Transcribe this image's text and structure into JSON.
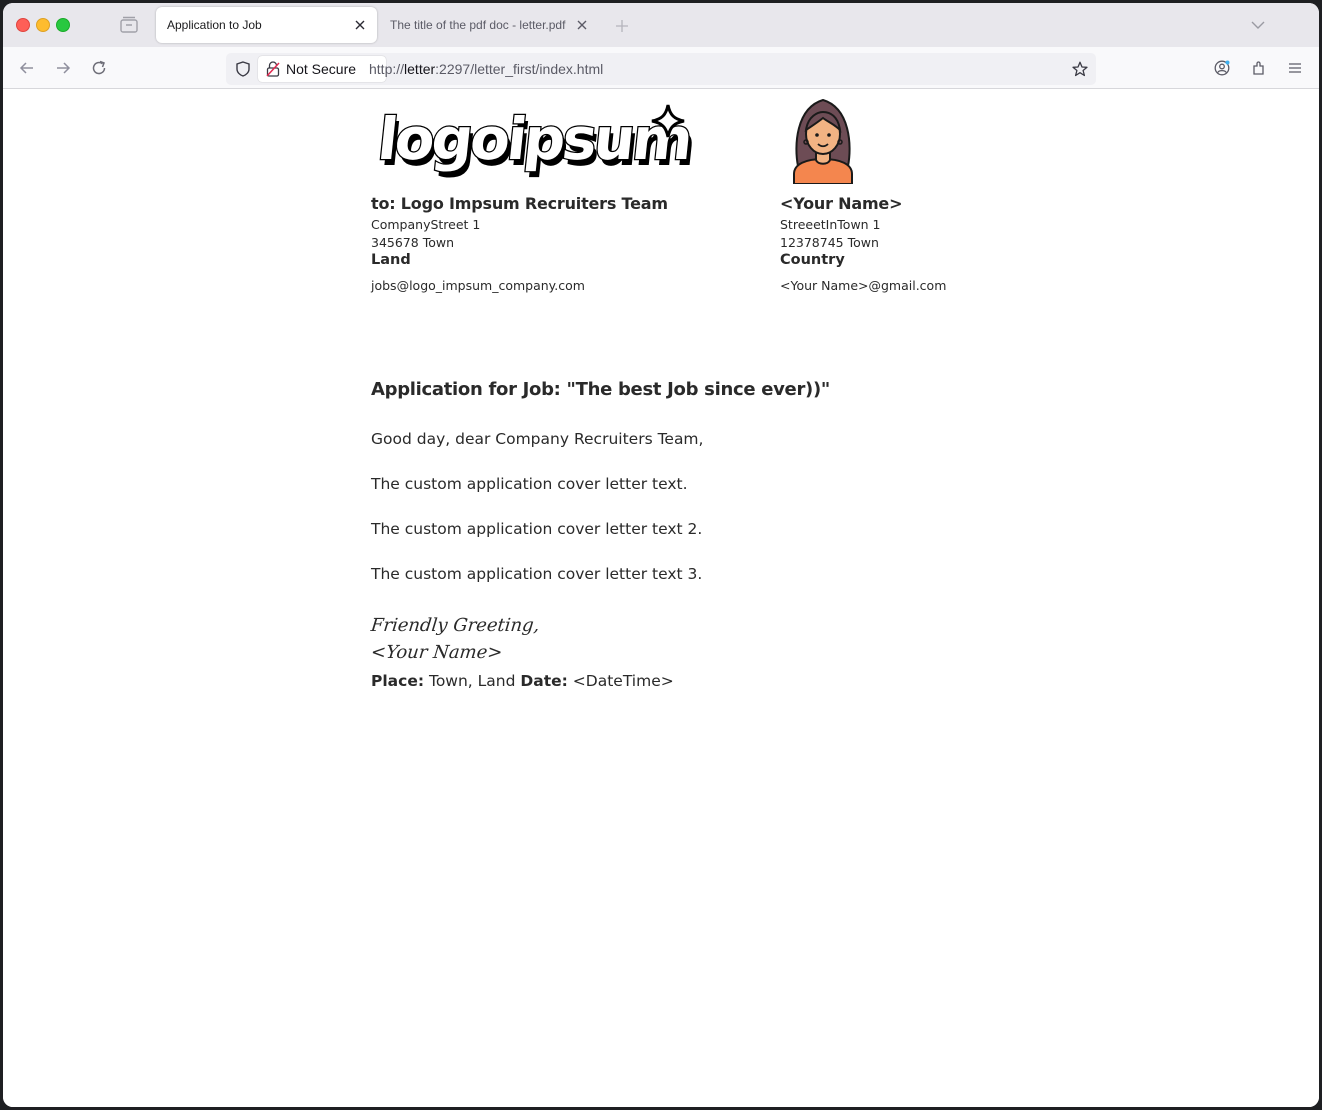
{
  "browser": {
    "tabs": [
      {
        "title": "Application to Job",
        "active": true
      },
      {
        "title": "The title of the pdf doc - letter.pdf",
        "active": false
      }
    ],
    "security_label": "Not Secure",
    "url_prefix": "http://",
    "url_host": "letter",
    "url_rest": ":2297/letter_first/index.html"
  },
  "letter": {
    "recipient": {
      "heading": "to: Logo Impsum Recruiters Team",
      "street": "CompanyStreet 1",
      "city": "345678  Town",
      "country": "Land",
      "email": "jobs@logo_impsum_company.com"
    },
    "sender": {
      "heading": "<Your Name>",
      "street": "StreeetInTown 1",
      "city": "12378745  Town",
      "country": "Country",
      "email": "<Your Name>@gmail.com"
    },
    "subject": "Application for Job: \"The best Job since ever))\"",
    "greeting": "Good day, dear Company Recruiters Team,",
    "paragraphs": [
      "The custom application cover letter text.",
      "The custom application cover letter text 2.",
      "The custom application cover letter text 3."
    ],
    "closing": "Friendly Greeting,",
    "signature": "<Your Name>",
    "place_label": "Place:",
    "place": "Town, Land",
    "date_label": "Date:",
    "date": "<DateTime>",
    "logo_text": "logoipsum"
  },
  "colors": {
    "avatar_shirt": "#f4864e",
    "avatar_skin": "#f2b383",
    "avatar_hair": "#6d4c55"
  }
}
